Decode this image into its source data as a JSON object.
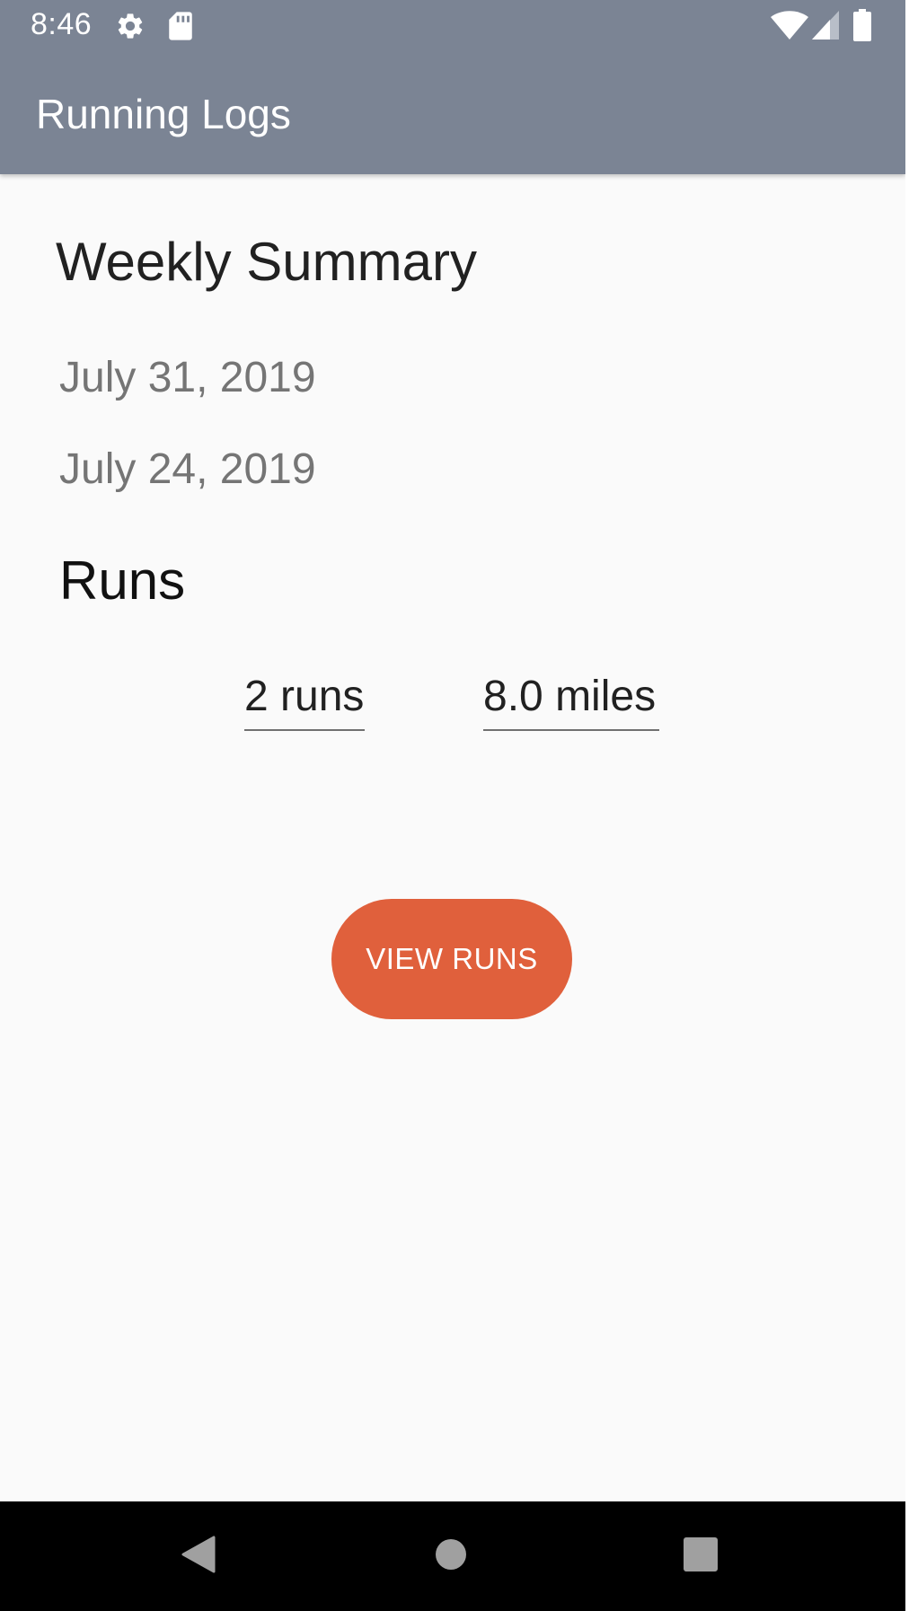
{
  "status_bar": {
    "time": "8:46",
    "icons": [
      "settings-icon",
      "sd-card-icon",
      "wifi-icon",
      "cell-signal-icon",
      "battery-icon"
    ]
  },
  "toolbar": {
    "title": "Running Logs"
  },
  "summary": {
    "heading": "Weekly Summary",
    "date_end": "July 31, 2019",
    "date_start": "July 24, 2019",
    "runs_heading": "Runs",
    "runs_count": "2 runs",
    "miles": "8.0 miles"
  },
  "actions": {
    "view_runs_label": "VIEW RUNS"
  },
  "navigation": {
    "icons": [
      "back-icon",
      "home-icon",
      "recents-icon"
    ]
  },
  "colors": {
    "app_bar": "#7b8494",
    "accent": "#e0603c",
    "background": "#fafafa"
  }
}
